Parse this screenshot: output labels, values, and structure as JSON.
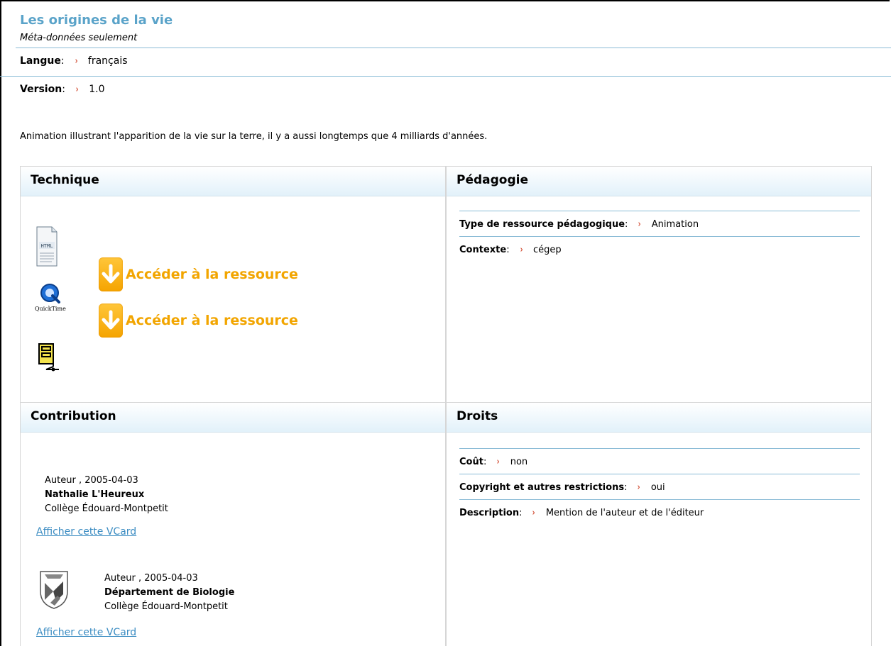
{
  "header": {
    "title": "Les origines de la vie",
    "subtitle": "Méta-données seulement"
  },
  "meta": [
    {
      "label": "Langue",
      "value": "français"
    },
    {
      "label": "Version",
      "value": "1.0"
    }
  ],
  "description": "Animation illustrant l'apparition de la vie sur la terre, il y a aussi longtemps que 4 milliards d'années.",
  "technique": {
    "title": "Technique",
    "icons": [
      "html-file-icon",
      "quicktime-icon",
      "archive-file-icon"
    ],
    "access_label_1": "Accéder à la ressource",
    "access_label_2": "Accéder à la ressource",
    "quicktime_text": "QuickTime",
    "html_text": "HTML"
  },
  "pedagogie": {
    "title": "Pédagogie",
    "fields": [
      {
        "label": "Type de ressource pédagogique",
        "value": "Animation"
      },
      {
        "label": "Contexte",
        "value": "cégep"
      }
    ]
  },
  "contribution": {
    "title": "Contribution",
    "contributors": [
      {
        "role": "Auteur , 2005-04-03",
        "name": "Nathalie L'Heureux",
        "org": "Collège Édouard-Montpetit",
        "vcard": "Afficher cette VCard"
      },
      {
        "role": "Auteur , 2005-04-03",
        "name": "Département de Biologie",
        "org": "Collège Édouard-Montpetit",
        "vcard": "Afficher cette VCard"
      }
    ]
  },
  "droits": {
    "title": "Droits",
    "fields": [
      {
        "label": "Coût",
        "value": "non"
      },
      {
        "label": "Copyright et autres restrictions",
        "value": "oui"
      },
      {
        "label": "Description",
        "value": "Mention de l'auteur et de l'éditeur"
      }
    ]
  },
  "colors": {
    "title": "#5aa3c9",
    "link": "#3b8cc2",
    "accent_orange": "#f5a400",
    "arrow_red": "#d0442a",
    "rule": "#8bbcd6"
  },
  "separator_glyph": "›"
}
